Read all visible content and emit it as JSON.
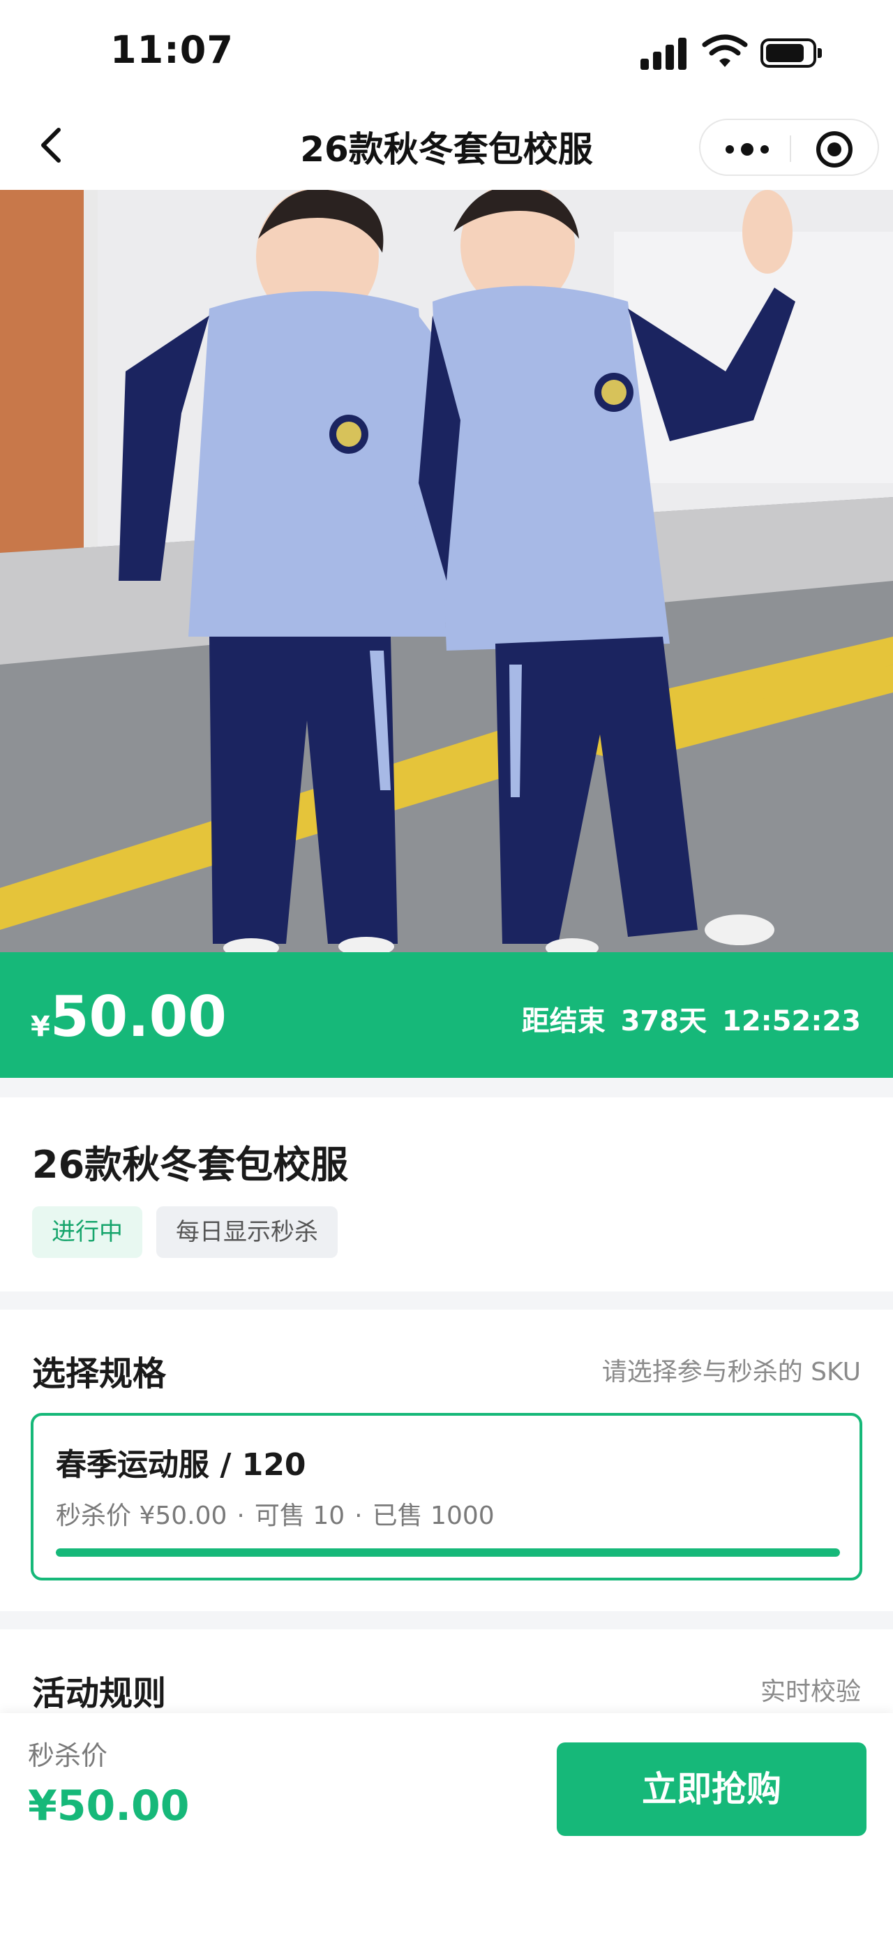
{
  "status_bar": {
    "time": "11:07"
  },
  "nav": {
    "title": "26款秋冬套包校服"
  },
  "banner": {
    "currency": "¥",
    "price": "50.00",
    "countdown_label": "距结束",
    "countdown_days": "378天",
    "countdown_time": "12:52:23"
  },
  "product": {
    "title": "26款秋冬套包校服",
    "tags": [
      "进行中",
      "每日显示秒杀"
    ]
  },
  "spec": {
    "title": "选择规格",
    "hint": "请选择参与秒杀的 SKU",
    "sku": {
      "name": "春季运动服 / 120",
      "price_text": "秒杀价 ¥50.00",
      "available_text": "可售 10",
      "sold_text": "已售 1000",
      "progress": 1.0
    }
  },
  "rules": {
    "title": "活动规则",
    "hint": "实时校验"
  },
  "bottom_bar": {
    "label": "秒杀价",
    "price": "¥50.00",
    "buy_label": "立即抢购"
  },
  "colors": {
    "accent": "#16b879",
    "accent_light": "#e8f8f1"
  }
}
